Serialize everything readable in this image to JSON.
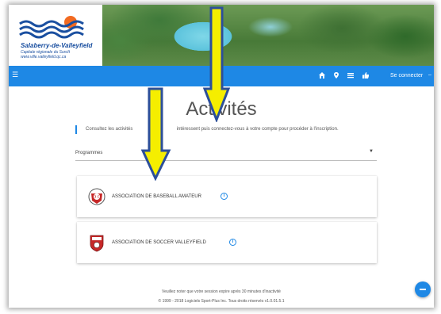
{
  "logo": {
    "name": "Salaberry-de-Valleyfield",
    "subtitle_1": "Capitale régionale du Suroît",
    "subtitle_2": "www.ville.valleyfield.qc.ca"
  },
  "navbar": {
    "login_label": "Se connecter",
    "icons": [
      "menu-icon",
      "home-icon",
      "location-pin-icon",
      "list-icon",
      "thumbs-up-icon"
    ]
  },
  "page": {
    "title": "Activités",
    "intro_left": "Consultez les activités",
    "intro_right": "intéressent puis connectez-vous à votre compte pour procéder à l'inscription."
  },
  "programs_select": {
    "label": "Programmes"
  },
  "associations": [
    {
      "name": "ASSOCIATION DE BASEBALL AMATEUR"
    },
    {
      "name": "ASSOCIATION DE SOCCER VALLEYFIELD"
    }
  ],
  "footer": {
    "session_notice": "Veuillez noter que votre session expire après 30 minutes d'inactivité",
    "copyright": "© 1999 - 2018 Logiciels Sport-Plus Inc. Tous droits réservés v1.0.01.5.1"
  },
  "colors": {
    "primary": "#1e88e5",
    "arrow_fill": "#f5ee00",
    "arrow_stroke": "#2c4f9a"
  }
}
